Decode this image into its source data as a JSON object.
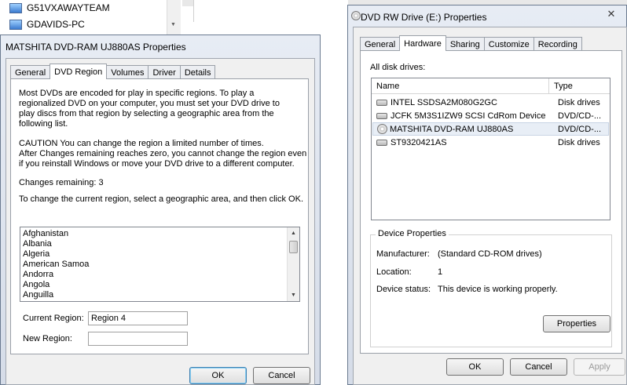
{
  "background": {
    "items": [
      {
        "label": "G51VXAWAYTEAM"
      },
      {
        "label": "GDAVIDS-PC"
      }
    ]
  },
  "left_window": {
    "title": "MATSHITA DVD-RAM UJ880AS Properties",
    "tabs": [
      "General",
      "DVD Region",
      "Volumes",
      "Driver",
      "Details"
    ],
    "active_tab": "DVD Region",
    "intro": [
      "Most DVDs are encoded for play in specific regions. To play a",
      "regionalized DVD on your computer, you must set your DVD drive to",
      "play discs from that region by selecting a geographic area from the",
      "following list."
    ],
    "caution": [
      "CAUTION   You can change the region a limited number of times.",
      "After Changes remaining reaches zero, you cannot change the region even",
      "if you reinstall Windows or move your DVD drive to a different computer."
    ],
    "changes_remaining": "Changes remaining: 3",
    "instruction": "To change the current region, select a geographic area, and then click OK.",
    "regions": [
      "Afghanistan",
      "Albania",
      "Algeria",
      "American Samoa",
      "Andorra",
      "Angola",
      "Anguilla"
    ],
    "current_region_label": "Current Region:",
    "current_region_value": "Region 4",
    "new_region_label": "New Region:",
    "new_region_value": "",
    "ok_label": "OK",
    "cancel_label": "Cancel"
  },
  "right_window": {
    "title": "DVD RW Drive (E:) Properties",
    "close_glyph": "✕",
    "tabs": [
      "General",
      "Hardware",
      "Sharing",
      "Customize",
      "Recording"
    ],
    "active_tab": "Hardware",
    "all_drives_label": "All disk drives:",
    "col_name": "Name",
    "col_type": "Type",
    "drives": [
      {
        "name": "INTEL SSDSA2M080G2GC",
        "type": "Disk drives",
        "icon": "hard-drive-icon",
        "selected": false
      },
      {
        "name": "JCFK 5M3S1IZW9 SCSI CdRom Device",
        "type": "DVD/CD-...",
        "icon": "cd-drive-icon",
        "selected": false
      },
      {
        "name": "MATSHITA DVD-RAM UJ880AS",
        "type": "DVD/CD-...",
        "icon": "cd-drive-icon",
        "selected": true
      },
      {
        "name": "ST9320421AS",
        "type": "Disk drives",
        "icon": "hard-drive-icon",
        "selected": false
      }
    ],
    "device_properties_label": "Device Properties",
    "manufacturer_label": "Manufacturer:",
    "manufacturer_value": "(Standard CD-ROM drives)",
    "location_label": "Location:",
    "location_value": "1",
    "status_label": "Device status:",
    "status_value": "This device is working properly.",
    "properties_label": "Properties",
    "ok_label": "OK",
    "cancel_label": "Cancel",
    "apply_label": "Apply"
  },
  "colors": {
    "frame": "#d5dce8",
    "client": "#f0f0f0",
    "default_button_border": "#3c7fb1",
    "selection": "#e8eef6"
  }
}
